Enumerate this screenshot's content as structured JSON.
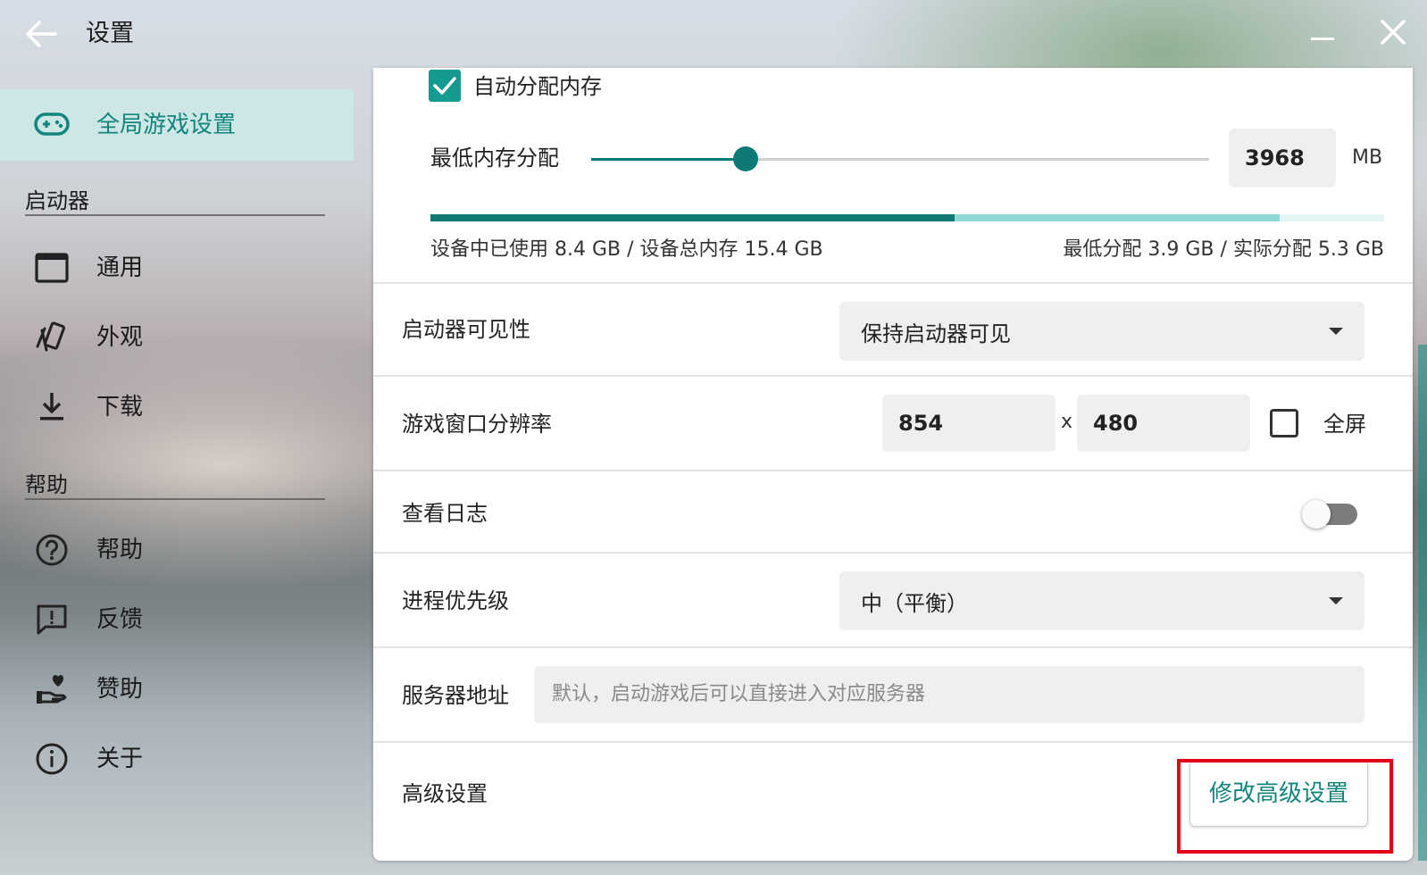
{
  "header": {
    "title": "设置"
  },
  "sidebar": {
    "active": {
      "label": "全局游戏设置",
      "icon": "gamepad-icon"
    },
    "sections": [
      {
        "title": "启动器",
        "items": [
          {
            "label": "通用",
            "icon": "window-icon"
          },
          {
            "label": "外观",
            "icon": "cards-icon"
          },
          {
            "label": "下载",
            "icon": "download-icon"
          }
        ]
      },
      {
        "title": "帮助",
        "items": [
          {
            "label": "帮助",
            "icon": "help-circle-icon"
          },
          {
            "label": "反馈",
            "icon": "feedback-icon"
          },
          {
            "label": "赞助",
            "icon": "donate-hand-heart-icon"
          },
          {
            "label": "关于",
            "icon": "info-icon"
          }
        ]
      }
    ]
  },
  "memory": {
    "auto_allocate_label": "自动分配内存",
    "auto_allocate_checked": true,
    "min_label": "最低内存分配",
    "min_value": "3968",
    "unit": "MB",
    "slider_fraction": 0.25,
    "usage_used_fraction": 0.55,
    "usage_allocated_fraction": 0.89,
    "usage_left_text": "设备中已使用 8.4 GB / 设备总内存 15.4 GB",
    "usage_right_text": "最低分配 3.9 GB / 实际分配 5.3 GB"
  },
  "launcher_visibility": {
    "label": "启动器可见性",
    "value": "保持启动器可见"
  },
  "resolution": {
    "label": "游戏窗口分辨率",
    "width": "854",
    "separator": "x",
    "height": "480",
    "fullscreen_label": "全屏",
    "fullscreen_checked": false
  },
  "logs": {
    "label": "查看日志",
    "enabled": false
  },
  "priority": {
    "label": "进程优先级",
    "value": "中（平衡）"
  },
  "server": {
    "label": "服务器地址",
    "placeholder": "默认，启动游戏后可以直接进入对应服务器"
  },
  "advanced": {
    "label": "高级设置",
    "button_label": "修改高级设置"
  },
  "colors": {
    "accent": "#14857d",
    "highlight": "#e3001b"
  }
}
